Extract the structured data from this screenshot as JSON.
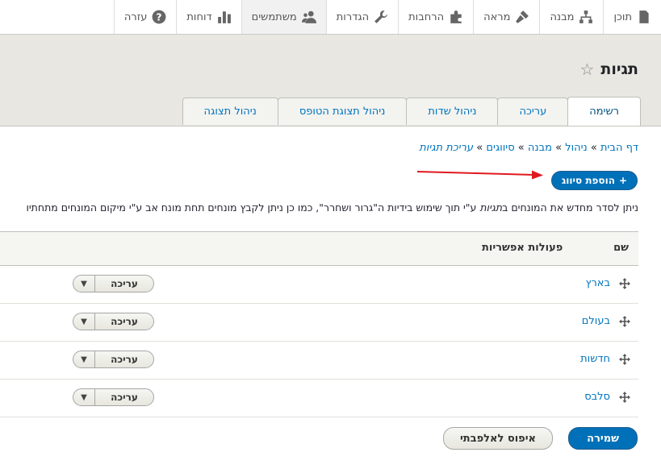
{
  "toolbar": {
    "items": [
      {
        "label": "תוכן",
        "icon": "file-icon"
      },
      {
        "label": "מבנה",
        "icon": "sitemap-icon"
      },
      {
        "label": "מראה",
        "icon": "paint-icon"
      },
      {
        "label": "הרחבות",
        "icon": "puzzle-icon"
      },
      {
        "label": "הגדרות",
        "icon": "wrench-icon"
      },
      {
        "label": "משתמשים",
        "icon": "users-icon"
      },
      {
        "label": "דוחות",
        "icon": "chart-icon"
      },
      {
        "label": "עזרה",
        "icon": "help-icon"
      }
    ]
  },
  "page": {
    "title": "תגיות",
    "star": "☆"
  },
  "tabs": [
    "רשימה",
    "עריכה",
    "ניהול שדות",
    "ניהול תצוגת הטופס",
    "ניהול תצוגה"
  ],
  "breadcrumb": {
    "items": [
      "דף הבית",
      "ניהול",
      "מבנה",
      "סיווגים"
    ],
    "separator": "»",
    "current": "עריכת תגיות"
  },
  "add_button": {
    "plus": "+",
    "label": "הוספת סיווג"
  },
  "help_text": {
    "part1": "ניתן לסדר מחדש את המונחים ב",
    "italic": "תגיות",
    "part2": " ע\"י תוך שימוש בידיות ה\"גרור ושחרר\", כמו כן ניתן לקבץ מונחים תחת מונח אב ע\"י מיקום המונחים מתחתיו"
  },
  "table": {
    "col_name": "שם",
    "col_ops": "פעולות אפשריות",
    "rows": [
      {
        "name": "בארץ",
        "edit": "עריכה"
      },
      {
        "name": "בעולם",
        "edit": "עריכה"
      },
      {
        "name": "חדשות",
        "edit": "עריכה"
      },
      {
        "name": "סלבס",
        "edit": "עריכה"
      }
    ],
    "toggle_glyph": "▼"
  },
  "actions": {
    "save": "שמירה",
    "reset": "איפוס לאלפבתי"
  },
  "colors": {
    "accent": "#0071b8",
    "link": "#0074bd",
    "arrow": "#e0191f"
  }
}
